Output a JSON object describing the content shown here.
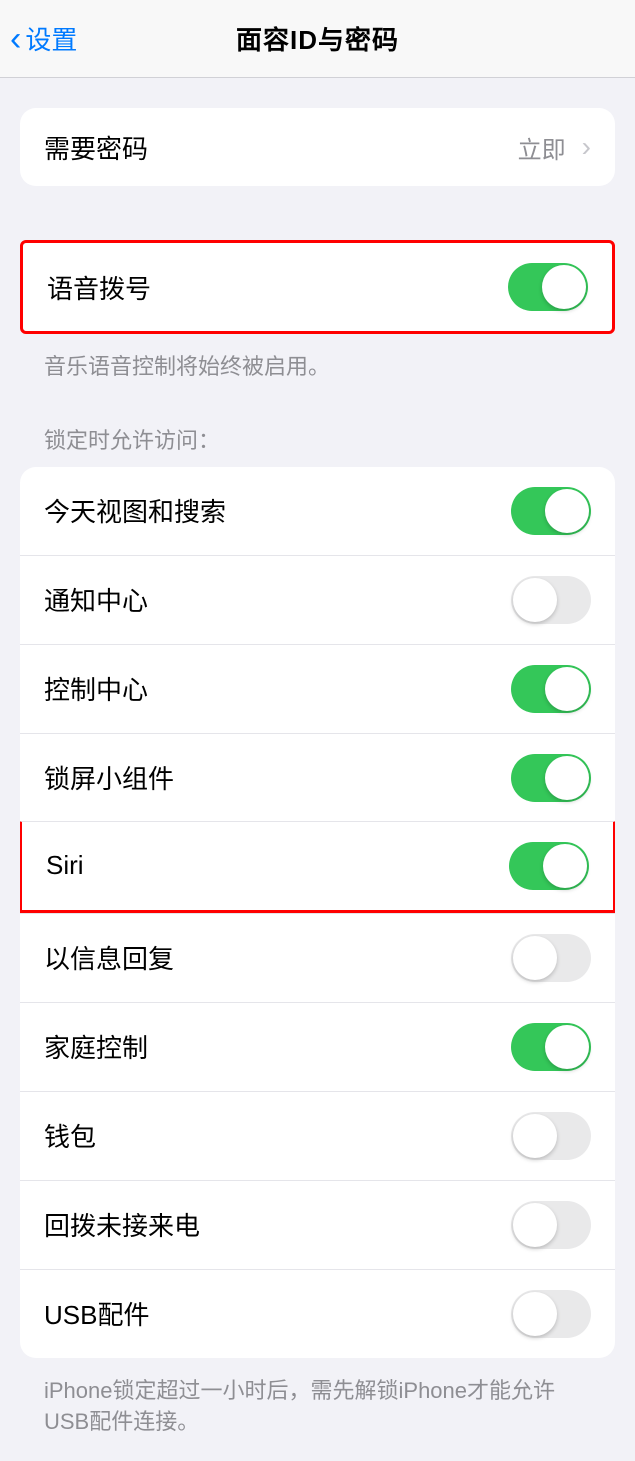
{
  "nav": {
    "back_label": "设置",
    "title": "面容ID与密码"
  },
  "passcode_section": {
    "require_passcode_label": "需要密码",
    "require_passcode_value": "立即"
  },
  "voice_dial_section": {
    "voice_dial_label": "语音拨号",
    "voice_dial_on": true,
    "footer": "音乐语音控制将始终被启用。"
  },
  "lock_access_section": {
    "header": "锁定时允许访问：",
    "items": [
      {
        "key": "today",
        "label": "今天视图和搜索",
        "on": true
      },
      {
        "key": "notifications",
        "label": "通知中心",
        "on": false
      },
      {
        "key": "control",
        "label": "控制中心",
        "on": true
      },
      {
        "key": "widgets",
        "label": "锁屏小组件",
        "on": true
      },
      {
        "key": "siri",
        "label": "Siri",
        "on": true,
        "highlighted": true
      },
      {
        "key": "reply",
        "label": "以信息回复",
        "on": false
      },
      {
        "key": "home",
        "label": "家庭控制",
        "on": true
      },
      {
        "key": "wallet",
        "label": "钱包",
        "on": false
      },
      {
        "key": "callback",
        "label": "回拨未接来电",
        "on": false
      },
      {
        "key": "usb",
        "label": "USB配件",
        "on": false
      }
    ],
    "footer": "iPhone锁定超过一小时后，需先解锁iPhone才能允许USB配件连接。"
  }
}
